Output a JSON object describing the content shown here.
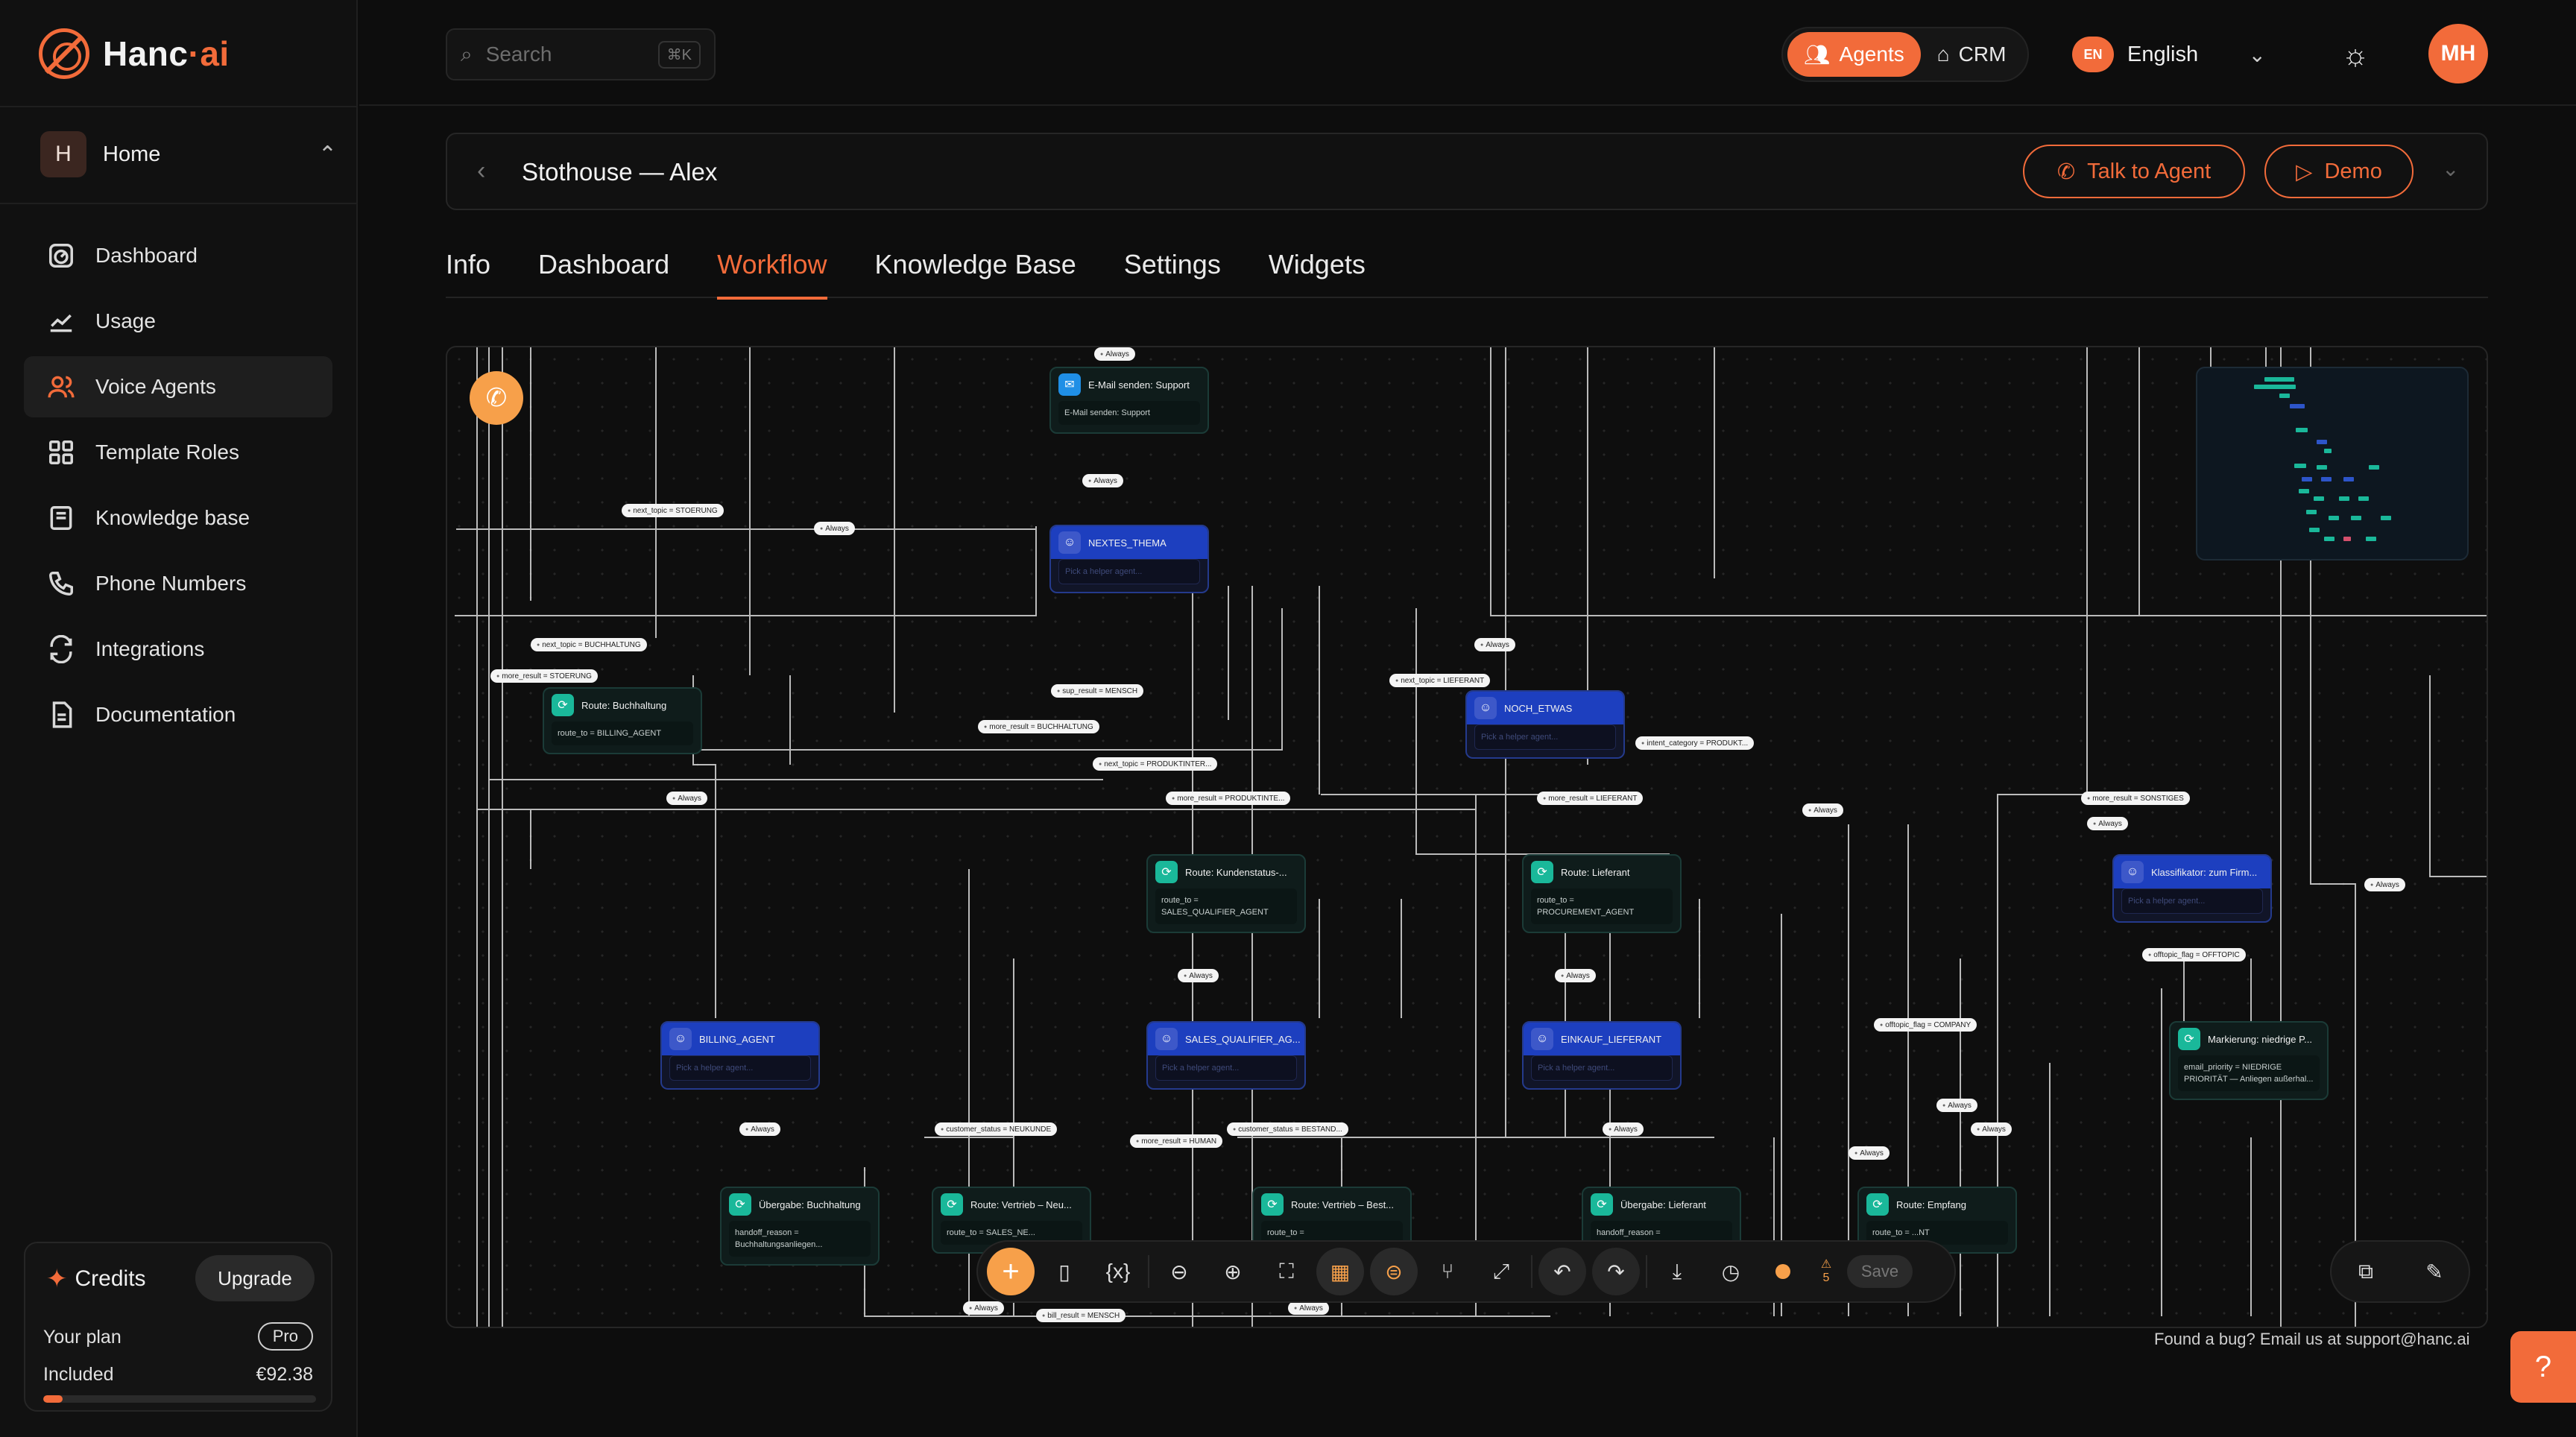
{
  "brand": {
    "name_main": "Hanc",
    "name_dot": "·",
    "name_ai": "ai"
  },
  "workspace": {
    "initial": "H",
    "name": "Home"
  },
  "nav": [
    {
      "label": "Dashboard",
      "icon": "gauge-icon"
    },
    {
      "label": "Usage",
      "icon": "chart-line-icon"
    },
    {
      "label": "Voice Agents",
      "icon": "users-icon",
      "active": true
    },
    {
      "label": "Template Roles",
      "icon": "grid-icon"
    },
    {
      "label": "Knowledge base",
      "icon": "book-icon"
    },
    {
      "label": "Phone Numbers",
      "icon": "phone-icon"
    },
    {
      "label": "Integrations",
      "icon": "refresh-icon"
    },
    {
      "label": "Documentation",
      "icon": "document-icon"
    }
  ],
  "credits": {
    "title": "Credits",
    "upgrade": "Upgrade",
    "plan_label": "Your plan",
    "plan": "Pro",
    "included_label": "Included",
    "included_value": "€92.38",
    "used_fraction": 0.07
  },
  "search": {
    "placeholder": "Search",
    "shortcut": "⌘K"
  },
  "mode": {
    "agents": "Agents",
    "crm": "CRM"
  },
  "language": {
    "code": "EN",
    "name": "English"
  },
  "user": {
    "initials": "MH"
  },
  "agent": {
    "title": "Stothouse — Alex",
    "talk": "Talk to Agent",
    "demo": "Demo"
  },
  "tabs": [
    "Info",
    "Dashboard",
    "Workflow",
    "Knowledge Base",
    "Settings",
    "Widgets"
  ],
  "active_tab": "Workflow",
  "workflow": {
    "nodes": {
      "email": {
        "title": "E-Mail senden: Support",
        "body": "E-Mail senden: Support"
      },
      "nextes": {
        "title": "NEXTES_THEMA",
        "body": "Pick a helper agent..."
      },
      "route_buchhaltung": {
        "title": "Route: Buchhaltung",
        "body": "route_to = BILLING_AGENT"
      },
      "noch_etwas": {
        "title": "NOCH_ETWAS",
        "body": "Pick a helper agent..."
      },
      "route_kundenstatus": {
        "title": "Route: Kundenstatus-...",
        "body": "route_to = SALES_QUALIFIER_AGENT"
      },
      "route_lieferant": {
        "title": "Route: Lieferant",
        "body": "route_to = PROCUREMENT_AGENT"
      },
      "klassifikator": {
        "title": "Klassifikator: zum Firm...",
        "body": "Pick a helper agent..."
      },
      "billing": {
        "title": "BILLING_AGENT",
        "body": "Pick a helper agent..."
      },
      "sales_qualifier": {
        "title": "SALES_QUALIFIER_AG...",
        "body": "Pick a helper agent..."
      },
      "einkauf": {
        "title": "EINKAUF_LIEFERANT",
        "body": "Pick a helper agent..."
      },
      "markierung": {
        "title": "Markierung: niedrige P...",
        "body": "email_priority = NIEDRIGE PRIORITÄT — Anliegen außerhal..."
      },
      "uebergabe_buch": {
        "title": "Übergabe: Buchhaltung",
        "body": "handoff_reason = Buchhaltungsanliegen..."
      },
      "vertrieb_neu": {
        "title": "Route: Vertrieb – Neu...",
        "body": "route_to = SALES_NE..."
      },
      "vertrieb_best": {
        "title": "Route: Vertrieb – Best...",
        "body": "route_to ="
      },
      "uebergabe_lief": {
        "title": "Übergabe: Lieferant",
        "body": "handoff_reason ="
      },
      "empfang": {
        "title": "Route: Empfang",
        "body": "route_to = ...NT"
      }
    },
    "edges": {
      "e1": "Always",
      "e2": "Always",
      "e3": "next_topic = STOERUNG",
      "e4": "Always",
      "e5": "next_topic = BUCHHALTUNG",
      "e6": "more_result = STOERUNG",
      "e7": "Always",
      "e8": "next_topic = LIEFERANT",
      "e9": "sup_result = MENSCH",
      "e10": "more_result = BUCHHALTUNG",
      "e11": "intent_category = PRODUKT...",
      "e12": "next_topic = PRODUKTINTER...",
      "e13": "Always",
      "e14": "more_result = PRODUKTINTE...",
      "e15": "more_result = LIEFERANT",
      "e16": "Always",
      "e17": "more_result = SONSTIGES",
      "e18": "Always",
      "e19": "Always",
      "e20": "Always",
      "e21": "offtopic_flag = OFFTOPIC",
      "e22": "offtopic_flag = COMPANY",
      "e23": "Always",
      "e24": "Always",
      "e25": "Always",
      "e26": "customer_status = NEUKUNDE",
      "e27": "more_result = HUMAN",
      "e28": "customer_status = BESTAND...",
      "e29": "Always",
      "e30": "Always",
      "e31": "Always",
      "e32": "bill_result = MENSCH",
      "e33": "Always",
      "e34": "Always"
    },
    "warnings": "5",
    "save": "Save"
  },
  "footer": {
    "bug_note": "Found a bug? Email us at support@hanc.ai"
  },
  "colors": {
    "accent": "#f26b3a",
    "agent_node": "#1d3fbf",
    "route_node": "#1ab89a"
  }
}
